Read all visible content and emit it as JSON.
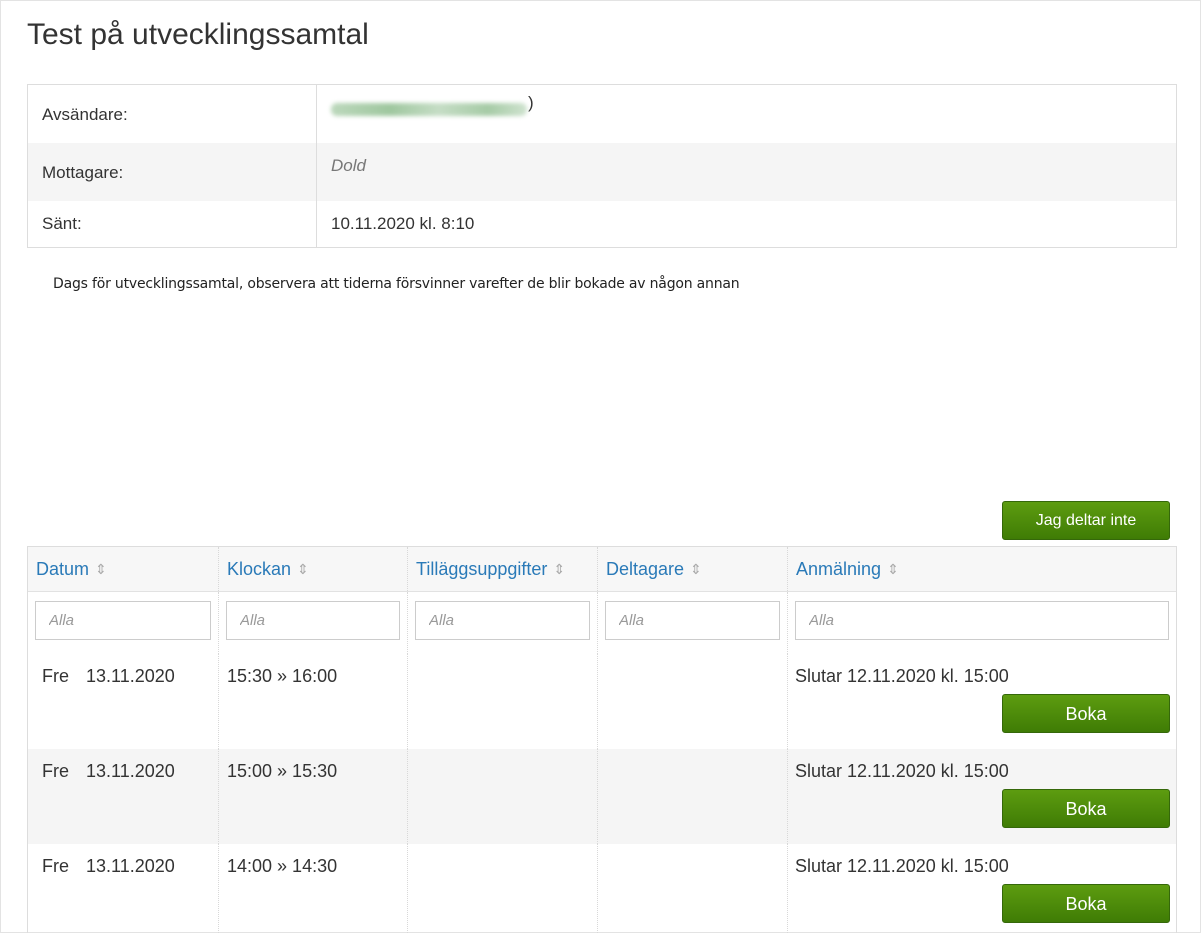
{
  "title": "Test på utvecklingssamtal",
  "meta": {
    "sender_label": "Avsändare:",
    "sender_suffix": ")",
    "recipient_label": "Mottagare:",
    "recipient_value": "Dold",
    "sent_label": "Sänt:",
    "sent_value": "10.11.2020 kl. 8:10"
  },
  "message": "Dags för utvecklingssamtal, observera att tiderna försvinner varefter de blir bokade av någon annan",
  "not_attending_button": "Jag deltar inte",
  "table": {
    "columns": [
      "Datum",
      "Klockan",
      "Tilläggsuppgifter",
      "Deltagare",
      "Anmälning"
    ],
    "filter_placeholder": "Alla",
    "rows": [
      {
        "day": "Fre",
        "date": "13.11.2020",
        "time": "15:30 » 16:00",
        "extra": "",
        "participants": "",
        "registration": "Slutar 12.11.2020 kl. 15:00",
        "button": "Boka"
      },
      {
        "day": "Fre",
        "date": "13.11.2020",
        "time": "15:00 » 15:30",
        "extra": "",
        "participants": "",
        "registration": "Slutar 12.11.2020 kl. 15:00",
        "button": "Boka"
      },
      {
        "day": "Fre",
        "date": "13.11.2020",
        "time": "14:00 » 14:30",
        "extra": "",
        "participants": "",
        "registration": "Slutar 12.11.2020 kl. 15:00",
        "button": "Boka"
      }
    ]
  },
  "colors": {
    "accent_link": "#2a7ab8",
    "button_green": "#4a8a0a"
  },
  "icons": {
    "sort": "sort-up-down-icon"
  }
}
